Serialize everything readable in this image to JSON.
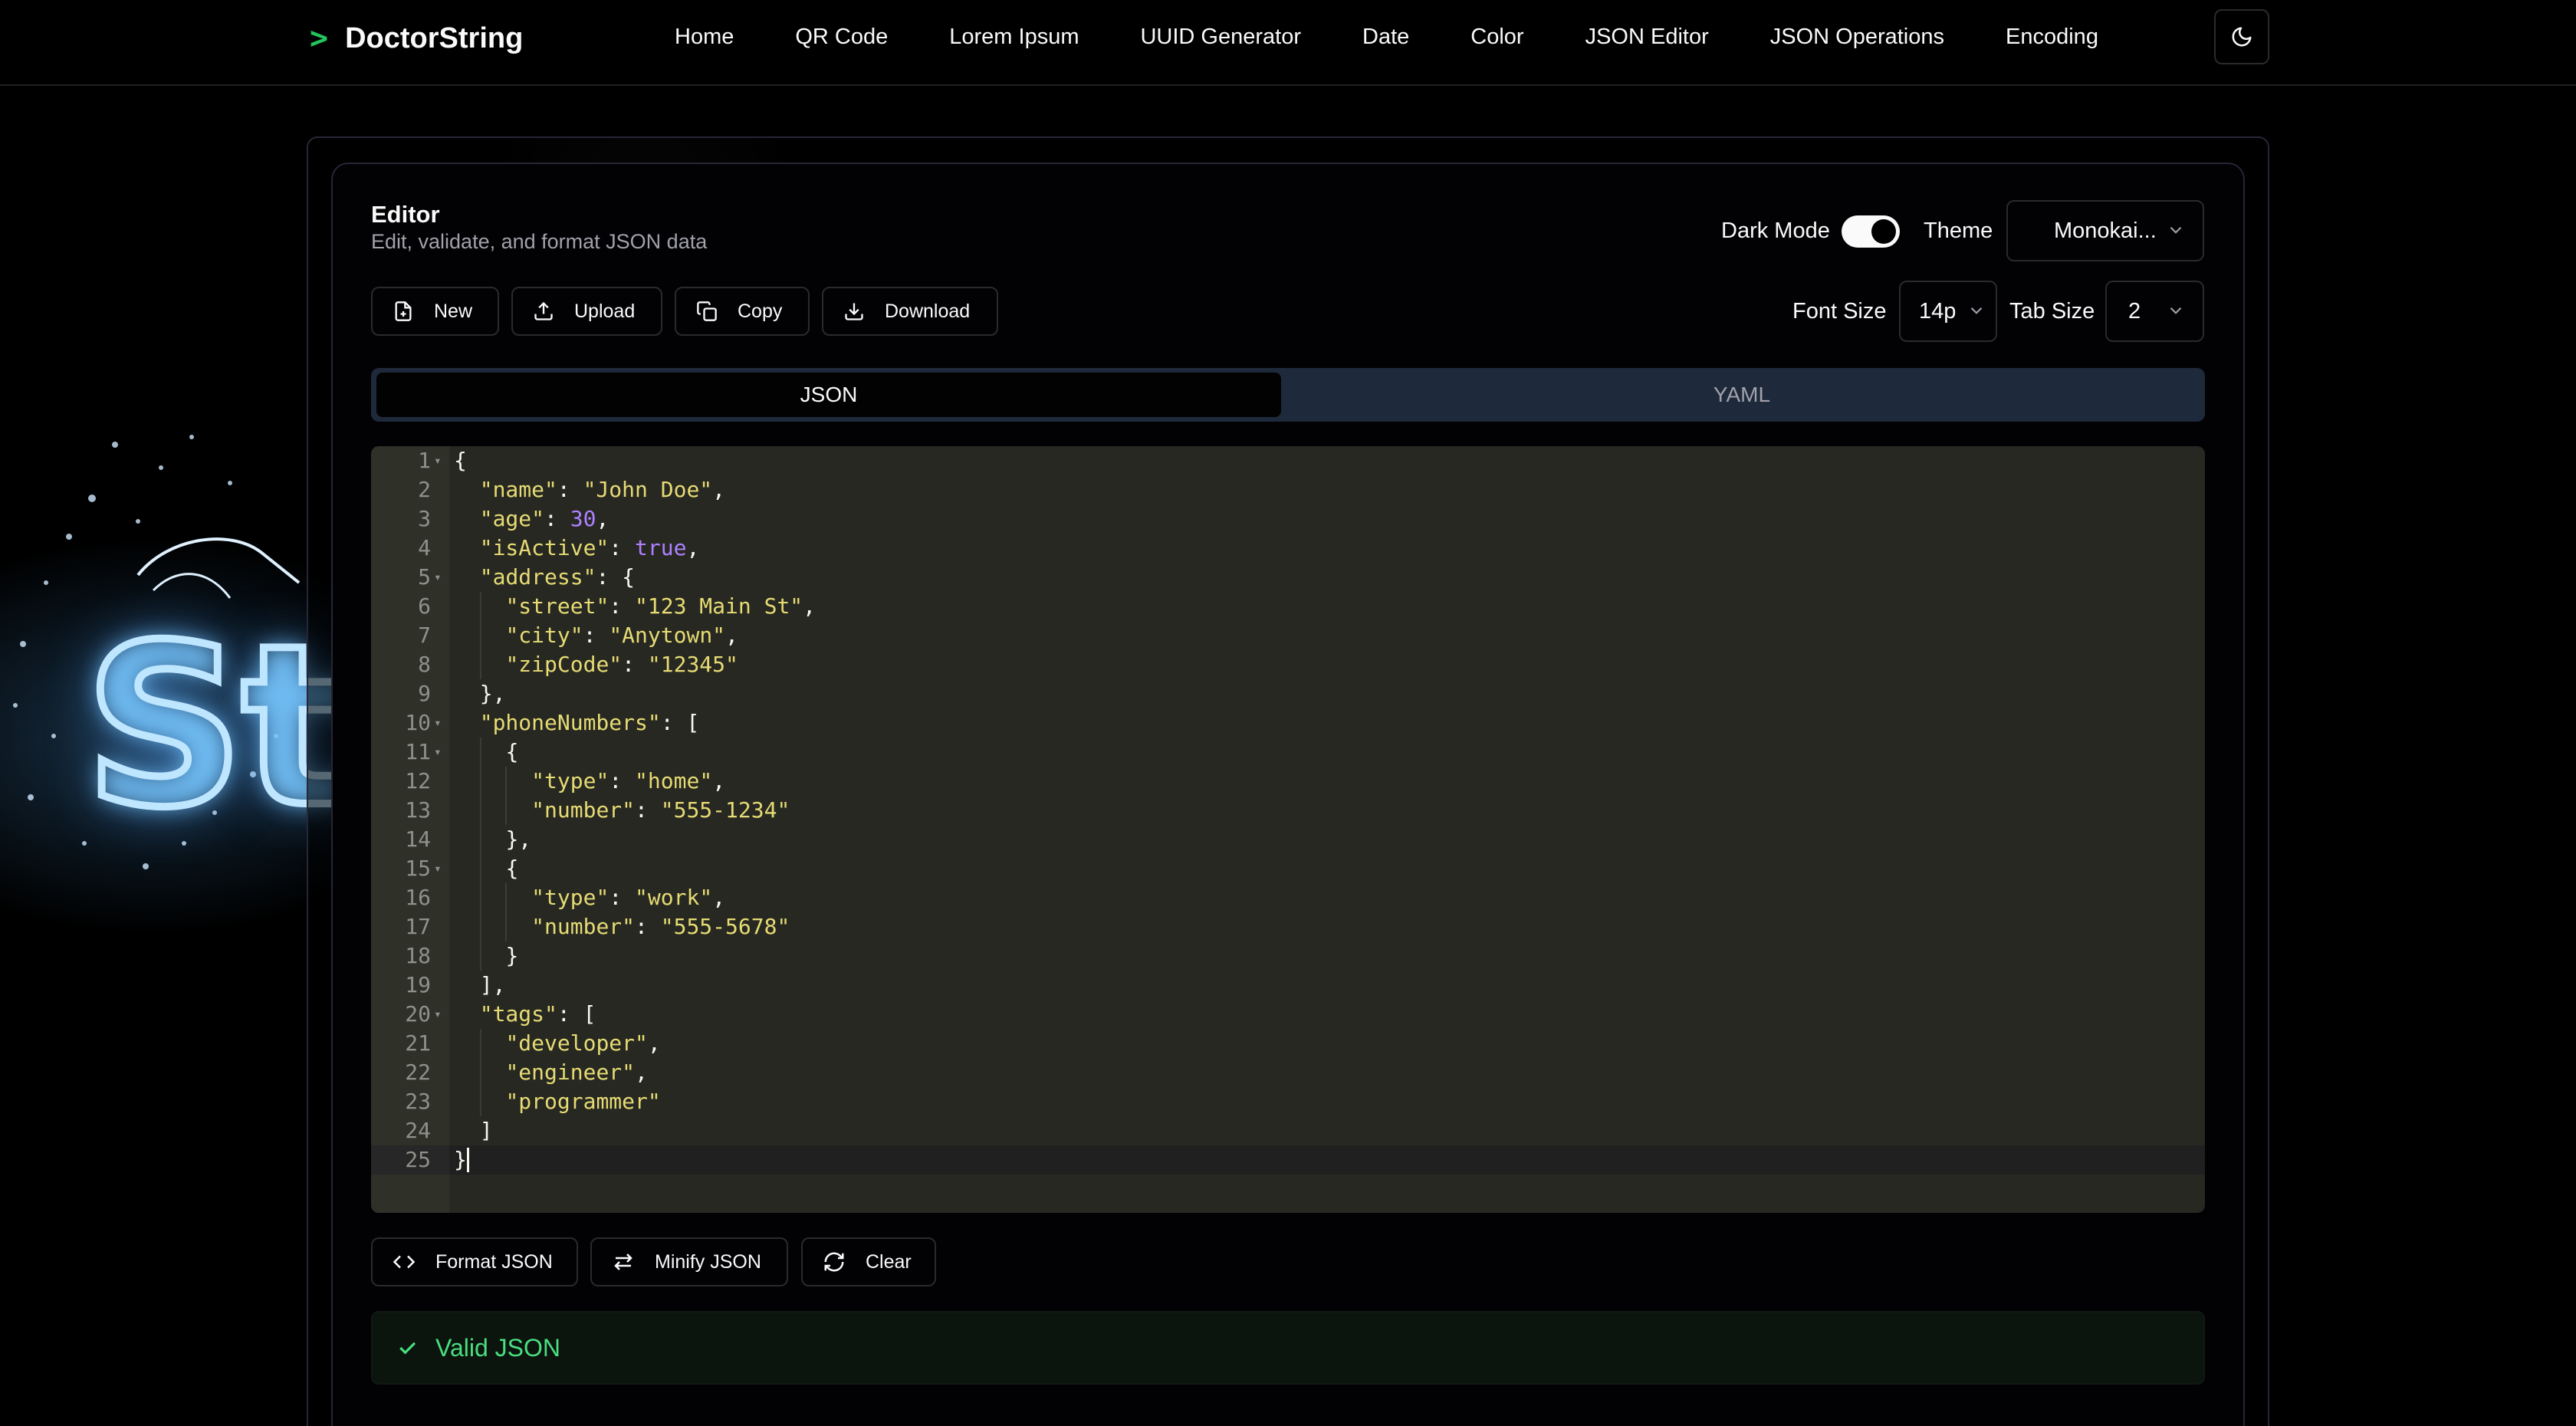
{
  "header": {
    "brand": "DoctorString",
    "nav": [
      "Home",
      "QR Code",
      "Lorem Ipsum",
      "UUID Generator",
      "Date",
      "Color",
      "JSON Editor",
      "JSON Operations",
      "Encoding"
    ]
  },
  "background": {
    "art_text": "St"
  },
  "editor": {
    "title": "Editor",
    "subtitle": "Edit, validate, and format JSON data",
    "dark_mode_label": "Dark Mode",
    "dark_mode_on": true,
    "theme_label": "Theme",
    "theme_value": "Monokai...",
    "font_size_label": "Font Size",
    "font_size_value": "14p",
    "tab_size_label": "Tab Size",
    "tab_size_value": "2",
    "toolbar": {
      "new": "New",
      "upload": "Upload",
      "copy": "Copy",
      "download": "Download"
    },
    "tabs": {
      "json": "JSON",
      "yaml": "YAML",
      "active": "JSON"
    },
    "actions": {
      "format": "Format JSON",
      "minify": "Minify JSON",
      "clear": "Clear"
    },
    "status": "Valid JSON"
  },
  "code": {
    "language": "json",
    "theme": "monokai",
    "lines": [
      "{",
      "  \"name\": \"John Doe\",",
      "  \"age\": 30,",
      "  \"isActive\": true,",
      "  \"address\": {",
      "    \"street\": \"123 Main St\",",
      "    \"city\": \"Anytown\",",
      "    \"zipCode\": \"12345\"",
      "  },",
      "  \"phoneNumbers\": [",
      "    {",
      "      \"type\": \"home\",",
      "      \"number\": \"555-1234\"",
      "    },",
      "    {",
      "      \"type\": \"work\",",
      "      \"number\": \"555-5678\"",
      "    }",
      "  ],",
      "  \"tags\": [",
      "    \"developer\",",
      "    \"engineer\",",
      "    \"programmer\"",
      "  ]",
      "}"
    ],
    "fold_lines": [
      1,
      5,
      10,
      11,
      15,
      20
    ],
    "active_line": 25
  },
  "colors": {
    "accent": "#22c55e",
    "valid": "#4ade80",
    "editor_bg": "#272822",
    "string": "#e6db74",
    "number": "#ae81ff"
  }
}
